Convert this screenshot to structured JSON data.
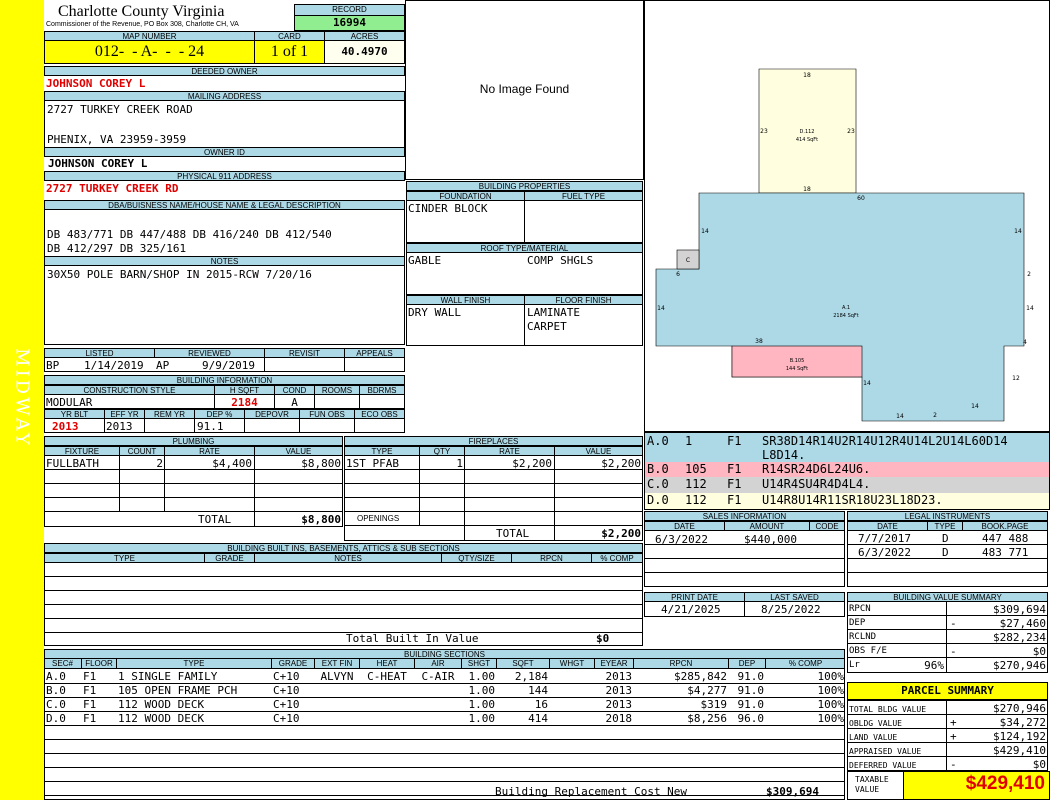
{
  "county": {
    "name": "Charlotte County Virginia",
    "commissioner": "Commissioner of the Revenue, PO Box 308, Charlotte CH, VA"
  },
  "sidebar": {
    "label": "MIDWAY"
  },
  "record": {
    "label": "RECORD",
    "value": "16994"
  },
  "map": {
    "label": "MAP NUMBER",
    "value": "012-  - A-  -  - 24"
  },
  "card": {
    "label": "CARD",
    "value": "1 of 1"
  },
  "acres": {
    "label": "ACRES",
    "value": "40.4970"
  },
  "owner": {
    "deeded_label": "DEEDED OWNER",
    "deeded": "JOHNSON COREY L",
    "mailing_label": "MAILING ADDRESS",
    "addr1": "2727 TURKEY CREEK ROAD",
    "addr2": "PHENIX, VA 23959-3959",
    "id_label": "OWNER ID",
    "id_value": "JOHNSON COREY L",
    "phys_label": "PHYSICAL 911 ADDRESS",
    "phys": "2727 TURKEY CREEK RD"
  },
  "dba": {
    "label": "DBA/BUISNESS NAME/HOUSE NAME & LEGAL DESCRIPTION",
    "line1": "DB 483/771 DB 447/488 DB 416/240 DB 412/540",
    "line2": "DB 412/297 DB 325/161"
  },
  "notes": {
    "label": "NOTES",
    "text": "30X50 POLE BARN/SHOP IN 2015-RCW 7/20/16"
  },
  "image": {
    "text": "No Image Found"
  },
  "dates": {
    "listed_label": "LISTED",
    "reviewed_label": "REVIEWED",
    "revisit_label": "REVISIT",
    "appeals_label": "APPEALS",
    "bp": "BP",
    "listed": "1/14/2019",
    "ap": "AP",
    "reviewed": "9/9/2019"
  },
  "bldg_info": {
    "label": "BUILDING INFORMATION",
    "style_label": "CONSTRUCTION STYLE",
    "hsqft_label": "H SQFT",
    "cond_label": "COND",
    "rooms_label": "ROOMS",
    "bdrms_label": "BDRMS",
    "style": "MODULAR",
    "hsqft": "2184",
    "cond": "A",
    "yrblt_label": "YR BLT",
    "effyr_label": "EFF YR",
    "remyr_label": "REM YR",
    "dep_label": "DEP %",
    "depovr_label": "DEPOVR",
    "funobs_label": "FUN OBS",
    "ecoobs_label": "ECO OBS",
    "yrblt": "2013",
    "effyr": "2013",
    "dep": "91.1"
  },
  "props": {
    "label": "BUILDING PROPERTIES",
    "foundation_label": "FOUNDATION",
    "fuel_label": "FUEL TYPE",
    "foundation": "CINDER BLOCK",
    "roof_label": "ROOF TYPE/MATERIAL",
    "roof1": "GABLE",
    "roof2": "COMP SHGLS",
    "wall_label": "WALL FINISH",
    "floor_label": "FLOOR FINISH",
    "wall": "DRY WALL",
    "floor1": "LAMINATE",
    "floor2": "CARPET"
  },
  "sketch": {
    "top_w": "18",
    "b112_l": "23",
    "b112_r": "23",
    "b112_label": "D.112",
    "b112_area": "414 SqFt",
    "b112_bottom": "18",
    "a_top": "60",
    "a_left": "14",
    "a_right": "14",
    "c_label": "C",
    "a_6": "6",
    "a_2": "2",
    "a_14l": "14",
    "a_14r": "14",
    "a_label": "A.1",
    "a_area": "2184 SqFt",
    "a_38": "38",
    "a_4": "4",
    "b105_label": "B.105",
    "b105_area": "144 SqFt",
    "a_14a": "14",
    "a_12": "12",
    "a_14b": "14",
    "a_2b": "2",
    "a_14c": "14"
  },
  "plumbing": {
    "label": "PLUMBING",
    "fixture_label": "FIXTURE",
    "count_label": "COUNT",
    "rate_label": "RATE",
    "value_label": "VALUE",
    "rows": [
      {
        "fixture": "FULLBATH",
        "count": "2",
        "rate": "$4,400",
        "value": "$8,800"
      }
    ],
    "total_label": "TOTAL",
    "total": "$8,800"
  },
  "fireplaces": {
    "label": "FIREPLACES",
    "type_label": "TYPE",
    "qty_label": "QTY",
    "rate_label": "RATE",
    "value_label": "VALUE",
    "rows": [
      {
        "type": "1ST PFAB",
        "qty": "1",
        "rate": "$2,200",
        "value": "$2,200"
      }
    ],
    "openings_label": "OPENINGS",
    "total_label": "TOTAL",
    "total": "$2,200"
  },
  "vectors": [
    {
      "id": "A.0",
      "num": "1",
      "fl": "F1",
      "code": "SR38D14R14U2R14U12R4U14L2U14L60D14",
      "code2": "L8D14.",
      "color": "#add8e6"
    },
    {
      "id": "B.0",
      "num": "105",
      "fl": "F1",
      "code": "R14SR24D6L24U6.",
      "color": "#ffb6c1"
    },
    {
      "id": "C.0",
      "num": "112",
      "fl": "F1",
      "code": "U14R4SU4R4D4L4.",
      "color": "#d3d3d3"
    },
    {
      "id": "D.0",
      "num": "112",
      "fl": "F1",
      "code": "U14R8U14R11SR18U23L18D23.",
      "color": "#ffffe0"
    }
  ],
  "sales": {
    "label": "SALES INFORMATION",
    "date_label": "DATE",
    "amount_label": "AMOUNT",
    "code_label": "CODE",
    "rows": [
      {
        "date": "6/3/2022",
        "amount": "$440,000",
        "code": ""
      }
    ]
  },
  "legal": {
    "label": "LEGAL INSTRUMENTS",
    "date_label": "DATE",
    "type_label": "TYPE",
    "book_label": "BOOK.PAGE",
    "rows": [
      {
        "date": "7/7/2017",
        "type": "D",
        "book": "447 488"
      },
      {
        "date": "6/3/2022",
        "type": "D",
        "book": "483 771"
      }
    ]
  },
  "builtins": {
    "label": "BUILDING BUILT INS, BASEMENTS, ATTICS & SUB SECTIONS",
    "type_label": "TYPE",
    "grade_label": "GRADE",
    "notes_label": "NOTES",
    "qty_label": "QTY/SIZE",
    "rpcn_label": "RPCN",
    "comp_label": "% COMP",
    "total_label": "Total Built In Value",
    "total": "$0"
  },
  "print": {
    "print_label": "PRINT DATE",
    "saved_label": "LAST SAVED",
    "print_date": "4/21/2025",
    "saved": "8/25/2022"
  },
  "value_summary": {
    "label": "BUILDING VALUE SUMMARY",
    "rows": [
      {
        "label": "RPCN",
        "sign": "",
        "value": "$309,694"
      },
      {
        "label": "DEP",
        "sign": "-",
        "value": "$27,460"
      },
      {
        "label": "RCLND",
        "sign": "",
        "value": "$282,234"
      },
      {
        "label": "OBS F/E",
        "sign": "-",
        "value": "$0"
      },
      {
        "label": "Lr",
        "sign": "96%",
        "value": "$270,946"
      }
    ]
  },
  "parcel": {
    "title": "PARCEL SUMMARY",
    "rows": [
      {
        "label": "TOTAL BLDG VALUE",
        "sign": "",
        "value": "$270,946"
      },
      {
        "label": "OBLDG VALUE",
        "sign": "+",
        "value": "$34,272"
      },
      {
        "label": "LAND VALUE",
        "sign": "+",
        "value": "$124,192"
      },
      {
        "label": "APPRAISED VALUE",
        "sign": "",
        "value": "$429,410"
      },
      {
        "label": "DEFERRED VALUE",
        "sign": "-",
        "value": "$0"
      }
    ],
    "taxable_label1": "TAXABLE",
    "taxable_label2": "VALUE",
    "taxable": "$429,410"
  },
  "sections": {
    "label": "BUILDING SECTIONS",
    "cols": [
      "SEC#",
      "FLOOR",
      "TYPE",
      "GRADE",
      "EXT FIN",
      "HEAT",
      "AIR",
      "SHGT",
      "SQFT",
      "WHGT",
      "EYEAR",
      "RPCN",
      "DEP",
      "% COMP"
    ],
    "rows": [
      {
        "sec": "A.0",
        "floor": "F1",
        "type": "1 SINGLE FAMILY",
        "grade": "C+10",
        "ext": "ALVYN",
        "heat": "C-HEAT",
        "air": "C-AIR",
        "shgt": "1.00",
        "sqft": "2,184",
        "whgt": "",
        "eyear": "2013",
        "rpcn": "$285,842",
        "dep": "91.0",
        "comp": "100%"
      },
      {
        "sec": "B.0",
        "floor": "F1",
        "type": "105 OPEN FRAME PCH",
        "grade": "C+10",
        "ext": "",
        "heat": "",
        "air": "",
        "shgt": "1.00",
        "sqft": "144",
        "whgt": "",
        "eyear": "2013",
        "rpcn": "$4,277",
        "dep": "91.0",
        "comp": "100%"
      },
      {
        "sec": "C.0",
        "floor": "F1",
        "type": "112 WOOD DECK",
        "grade": "C+10",
        "ext": "",
        "heat": "",
        "air": "",
        "shgt": "1.00",
        "sqft": "16",
        "whgt": "",
        "eyear": "2013",
        "rpcn": "$319",
        "dep": "91.0",
        "comp": "100%"
      },
      {
        "sec": "D.0",
        "floor": "F1",
        "type": "112 WOOD DECK",
        "grade": "C+10",
        "ext": "",
        "heat": "",
        "air": "",
        "shgt": "1.00",
        "sqft": "414",
        "whgt": "",
        "eyear": "2018",
        "rpcn": "$8,256",
        "dep": "96.0",
        "comp": "100%"
      }
    ],
    "total_label": "Building Replacement Cost New",
    "total": "$309,694"
  }
}
